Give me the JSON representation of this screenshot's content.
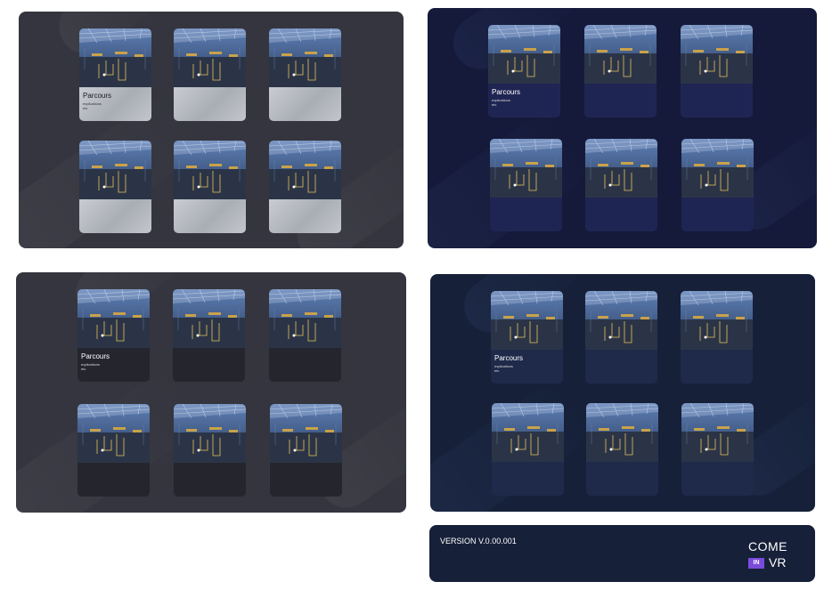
{
  "menus": [
    {
      "id": "gray-light",
      "cards": [
        {
          "title": "Parcours",
          "line1": "explications",
          "line2": "etc"
        },
        {
          "title": "",
          "line1": "",
          "line2": ""
        },
        {
          "title": "",
          "line1": "",
          "line2": ""
        },
        {
          "title": "",
          "line1": "",
          "line2": ""
        },
        {
          "title": "",
          "line1": "",
          "line2": ""
        },
        {
          "title": "",
          "line1": "",
          "line2": ""
        }
      ]
    },
    {
      "id": "navy",
      "cards": [
        {
          "title": "Parcours",
          "line1": "explications",
          "line2": "etc"
        },
        {
          "title": "",
          "line1": "",
          "line2": ""
        },
        {
          "title": "",
          "line1": "",
          "line2": ""
        },
        {
          "title": "",
          "line1": "",
          "line2": ""
        },
        {
          "title": "",
          "line1": "",
          "line2": ""
        },
        {
          "title": "",
          "line1": "",
          "line2": ""
        }
      ]
    },
    {
      "id": "gray-dark",
      "cards": [
        {
          "title": "Parcours",
          "line1": "explications",
          "line2": "etc"
        },
        {
          "title": "",
          "line1": "",
          "line2": ""
        },
        {
          "title": "",
          "line1": "",
          "line2": ""
        },
        {
          "title": "",
          "line1": "",
          "line2": ""
        },
        {
          "title": "",
          "line1": "",
          "line2": ""
        },
        {
          "title": "",
          "line1": "",
          "line2": ""
        }
      ]
    },
    {
      "id": "navy2",
      "cards": [
        {
          "title": "Parcours",
          "line1": "explications",
          "line2": "etc"
        },
        {
          "title": "",
          "line1": "",
          "line2": ""
        },
        {
          "title": "",
          "line1": "",
          "line2": ""
        },
        {
          "title": "",
          "line1": "",
          "line2": ""
        },
        {
          "title": "",
          "line1": "",
          "line2": ""
        },
        {
          "title": "",
          "line1": "",
          "line2": ""
        }
      ]
    }
  ],
  "footer": {
    "version": "VERSION V.0.00.001",
    "logo_top": "COME",
    "logo_badge": "IN",
    "logo_bottom": "VR"
  },
  "colors": {
    "panel_gray": "#34353e",
    "panel_navy": "#151a3a",
    "panel_navy2": "#162039",
    "logo_badge": "#7a4bdb"
  }
}
